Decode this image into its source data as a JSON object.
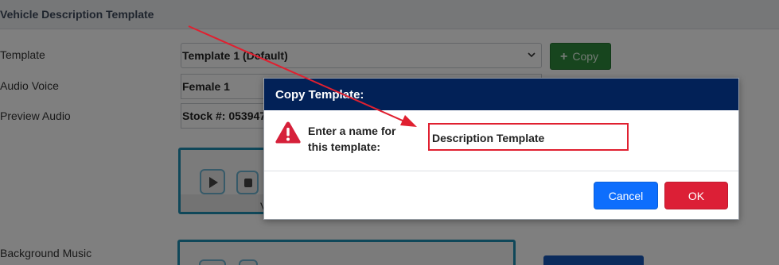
{
  "page": {
    "panel_title": "Vehicle Description Template",
    "labels": {
      "template": "Template",
      "audio_voice": "Audio Voice",
      "preview_audio": "Preview Audio",
      "background_music": "Background Music"
    },
    "template_select_value": "Template 1 (Default)",
    "copy_button_label": "Copy",
    "audio_voice_value": "Female 1",
    "stock_value": "Stock #: 053947",
    "player_caption": "V"
  },
  "dialog": {
    "title": "Copy Template:",
    "prompt": "Enter a name for this template:",
    "input_value": "Description Template",
    "cancel_label": "Cancel",
    "ok_label": "OK"
  },
  "colors": {
    "dialog_header": "#022157",
    "cancel": "#0d6efd",
    "ok": "#dc1f36",
    "annotation": "#e02030",
    "copy_button": "#2f8a3c"
  },
  "icons": {
    "warning": "warning-triangle-icon",
    "chevron": "chevron-down-icon",
    "plus": "plus-icon",
    "play": "play-icon",
    "stop": "stop-icon"
  }
}
